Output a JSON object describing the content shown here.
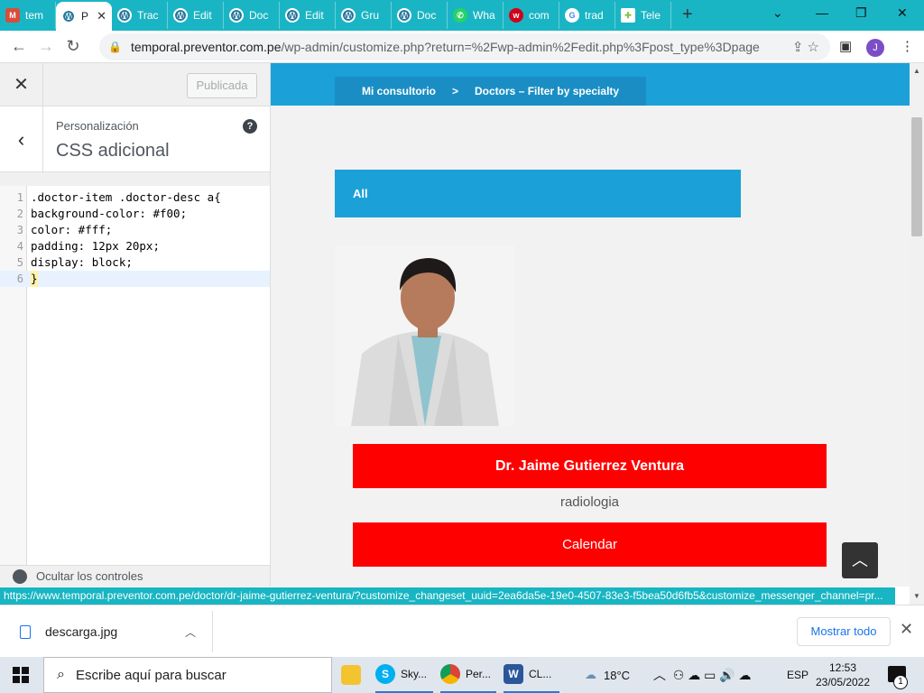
{
  "browser": {
    "tabs": [
      {
        "label": "tem",
        "icon": "calendar-icon"
      },
      {
        "label": "P",
        "icon": "wordpress-icon",
        "active": true
      },
      {
        "label": "Trac",
        "icon": "wordpress-icon"
      },
      {
        "label": "Edit",
        "icon": "wordpress-icon"
      },
      {
        "label": "Doc",
        "icon": "wordpress-icon"
      },
      {
        "label": "Edit",
        "icon": "wordpress-icon"
      },
      {
        "label": "Gru",
        "icon": "wordpress-icon"
      },
      {
        "label": "Doc",
        "icon": "wordpress-icon"
      },
      {
        "label": "Wha",
        "icon": "whatsapp-icon"
      },
      {
        "label": "com",
        "icon": "w-icon"
      },
      {
        "label": "trad",
        "icon": "google-icon"
      },
      {
        "label": "Tele",
        "icon": "tele-icon"
      }
    ],
    "url_host": "temporal.preventor.com.pe",
    "url_path": "/wp-admin/customize.php?return=%2Fwp-admin%2Fedit.php%3Fpost_type%3Dpage",
    "profile_initial": "J"
  },
  "customizer": {
    "publish_label": "Publicada",
    "breadcrumb": "Personalización",
    "title": "CSS adicional",
    "help": "?",
    "code_lines": [
      {
        "n": "1",
        "text": ".doctor-item .doctor-desc a{"
      },
      {
        "n": "2",
        "text": "background-color: #f00;"
      },
      {
        "n": "3",
        "text": "color: #fff;"
      },
      {
        "n": "4",
        "text": "padding: 12px 20px;"
      },
      {
        "n": "5",
        "text": "display: block;"
      },
      {
        "n": "6",
        "text": "}"
      }
    ],
    "footer_label": "Ocultar los controles"
  },
  "preview": {
    "breadcrumb_home": "Mi consultorio",
    "breadcrumb_sep": ">",
    "breadcrumb_current": "Doctors – Filter by specialty",
    "filter_label": "All",
    "doctor_name": "Dr. Jaime Gutierrez Ventura",
    "doctor_specialty": "radiologia",
    "calendar_label": "Calendar"
  },
  "status_url": "https://www.temporal.preventor.com.pe/doctor/dr-jaime-gutierrez-ventura/?customize_changeset_uuid=2ea6da5e-19e0-4507-83e3-f5bea50d6fb5&customize_messenger_channel=pr...",
  "downloads": {
    "file": "descarga.jpg",
    "show_all": "Mostrar todo"
  },
  "taskbar": {
    "search_placeholder": "Escribe aquí para buscar",
    "apps": [
      {
        "label": "",
        "icon": "file-explorer-icon"
      },
      {
        "label": "Sky...",
        "icon": "skype-icon"
      },
      {
        "label": "Per...",
        "icon": "chrome-icon"
      },
      {
        "label": "CL...",
        "icon": "word-icon"
      }
    ],
    "temperature": "18°C",
    "language": "ESP",
    "time": "12:53",
    "date": "23/05/2022",
    "notifications": "1"
  },
  "colors": {
    "tabstrip": "#1ab5c4",
    "preview_header": "#1ba0d8",
    "doctor_button": "#ff0000"
  }
}
